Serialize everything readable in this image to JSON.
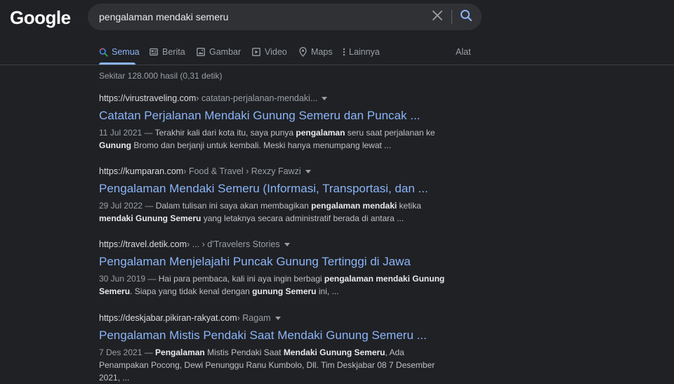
{
  "logo": "Google",
  "search": {
    "query": "pengalaman mendaki semeru"
  },
  "tabs": [
    {
      "label": "Semua",
      "icon": "search-icon",
      "active": true
    },
    {
      "label": "Berita",
      "icon": "news-icon"
    },
    {
      "label": "Gambar",
      "icon": "image-icon"
    },
    {
      "label": "Video",
      "icon": "video-icon"
    },
    {
      "label": "Maps",
      "icon": "map-pin-icon"
    },
    {
      "label": "Lainnya",
      "icon": "more-vert-icon"
    }
  ],
  "tools_label": "Alat",
  "stats": "Sekitar 128.000 hasil (0,31 detik)",
  "colors": {
    "background": "#202124",
    "link": "#8ab4f8",
    "text": "#bdc1c6",
    "muted": "#9aa0a6"
  },
  "results": [
    {
      "site": "https://virustraveling.com",
      "path": " › catatan-perjalanan-mendaki...",
      "title": "Catatan Perjalanan Mendaki Gunung Semeru dan Puncak ...",
      "date": "11 Jul 2021 — ",
      "snippet": [
        {
          "t": "Terakhir kali dari kota itu, saya punya "
        },
        {
          "t": "pengalaman",
          "b": true
        },
        {
          "t": " seru saat perjalanan ke "
        },
        {
          "t": "Gunung",
          "b": true
        },
        {
          "t": " Bromo dan berjanji untuk kembali. Meski hanya menumpang lewat ..."
        }
      ]
    },
    {
      "site": "https://kumparan.com",
      "path": " › Food & Travel › Rexzy Fawzi",
      "title": "Pengalaman Mendaki Semeru (Informasi, Transportasi, dan ...",
      "date": "29 Jul 2022 — ",
      "snippet": [
        {
          "t": "Dalam tulisan ini saya akan membagikan "
        },
        {
          "t": "pengalaman mendaki",
          "b": true
        },
        {
          "t": " ketika "
        },
        {
          "t": "mendaki Gunung Semeru",
          "b": true
        },
        {
          "t": " yang letaknya secara administratif berada di antara ..."
        }
      ]
    },
    {
      "site": "https://travel.detik.com",
      "path": " › ... › d'Travelers Stories",
      "title": "Pengalaman Menjelajahi Puncak Gunung Tertinggi di Jawa",
      "date": "30 Jun 2019 — ",
      "snippet": [
        {
          "t": "Hai para pembaca, kali ini aya ingin berbagi "
        },
        {
          "t": "pengalaman mendaki Gunung Semeru",
          "b": true
        },
        {
          "t": ". Siapa yang tidak kenal dengan "
        },
        {
          "t": "gunung Semeru",
          "b": true
        },
        {
          "t": " ini, ..."
        }
      ]
    },
    {
      "site": "https://deskjabar.pikiran-rakyat.com",
      "path": " › Ragam",
      "title": "Pengalaman Mistis Pendaki Saat Mendaki Gunung Semeru ...",
      "date": "7 Des 2021 — ",
      "snippet": [
        {
          "t": "Pengalaman",
          "b": true
        },
        {
          "t": " Mistis Pendaki Saat "
        },
        {
          "t": "Mendaki Gunung Semeru",
          "b": true
        },
        {
          "t": ", Ada Penampakan Pocong, Dewi Penunggu Ranu Kumbolo, Dll. Tim Deskjabar 08 7 Desember 2021, ..."
        }
      ]
    }
  ]
}
